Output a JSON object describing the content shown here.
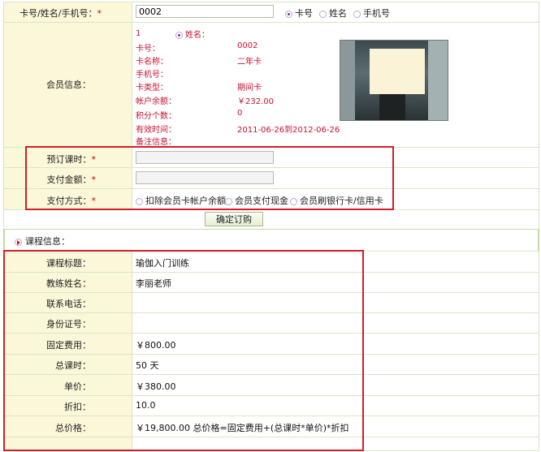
{
  "search": {
    "label": "卡号/姓名/手机号：",
    "required": "*",
    "value": "0002",
    "options": [
      "卡号",
      "姓名",
      "手机号"
    ],
    "selected": "卡号"
  },
  "member": {
    "label": "会员信息：",
    "index": "1",
    "name_label": "姓名：",
    "fields": [
      {
        "label": "卡号：",
        "value": "0002"
      },
      {
        "label": "卡名称：",
        "value": "二年卡"
      },
      {
        "label": "手机号：",
        "value": ""
      },
      {
        "label": "卡类型：",
        "value": "期间卡"
      },
      {
        "label": "帐户余额：",
        "value": "￥232.00"
      },
      {
        "label": "积分个数：",
        "value": "0"
      },
      {
        "label": "有效时间：",
        "value": "2011-06-26到2012-06-26"
      },
      {
        "label": "备注信息：",
        "value": ""
      }
    ]
  },
  "booking": {
    "hours_label": "预订课时：",
    "amount_label": "支付金额：",
    "method_label": "支付方式：",
    "required": "*",
    "hours_value": "",
    "amount_value": "",
    "methods": [
      "扣除会员卡帐户余额",
      "会员支付现金",
      "会员刷银行卡/信用卡"
    ],
    "submit": "确定订购"
  },
  "course": {
    "section_title": "课程信息：",
    "rows": [
      {
        "label": "课程标题：",
        "value": "瑜伽入门训练"
      },
      {
        "label": "教练姓名：",
        "value": "李丽老师"
      },
      {
        "label": "联系电话：",
        "value": ""
      },
      {
        "label": "身份证号：",
        "value": ""
      },
      {
        "label": "固定费用：",
        "value": "￥800.00"
      },
      {
        "label": "总课时：",
        "value": "50 天"
      },
      {
        "label": "单价：",
        "value": "￥380.00"
      },
      {
        "label": "折扣：",
        "value": "10.0"
      },
      {
        "label": "总价格：",
        "value": "￥19,800.00  总价格=固定费用+(总课时*单价)*折扣"
      }
    ]
  },
  "colors": {
    "label_bg": "#fbf7d9",
    "accent_red": "#c8102e",
    "border": "#d9e6c4",
    "highlight": "#d21e2b"
  }
}
